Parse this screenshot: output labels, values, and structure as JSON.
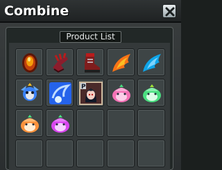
{
  "window": {
    "title": "Combine",
    "close_symbol": "✕"
  },
  "product_list": {
    "header": "Product List",
    "slots": [
      {
        "item": "fire-gem-icon"
      },
      {
        "item": "red-claw-gloves-icon"
      },
      {
        "item": "red-boots-icon"
      },
      {
        "item": "flame-wing-icon"
      },
      {
        "item": "ice-wing-icon"
      },
      {
        "item": "blue-dragon-pet-icon"
      },
      {
        "item": "wind-orb-icon"
      },
      {
        "item": "portrait-card-icon",
        "badge": "P"
      },
      {
        "item": "pink-slime-icon"
      },
      {
        "item": "green-slime-icon"
      },
      {
        "item": "orange-slime-icon"
      },
      {
        "item": "magenta-slime-icon"
      },
      {
        "item": "empty"
      },
      {
        "item": "empty"
      },
      {
        "item": "empty"
      },
      {
        "item": "empty"
      },
      {
        "item": "empty"
      },
      {
        "item": "empty"
      },
      {
        "item": "empty"
      },
      {
        "item": "empty"
      }
    ]
  },
  "colors": {
    "title_text": "#ffffff",
    "panel_bg": "#34393a",
    "slot_bg": "#3e4546"
  }
}
